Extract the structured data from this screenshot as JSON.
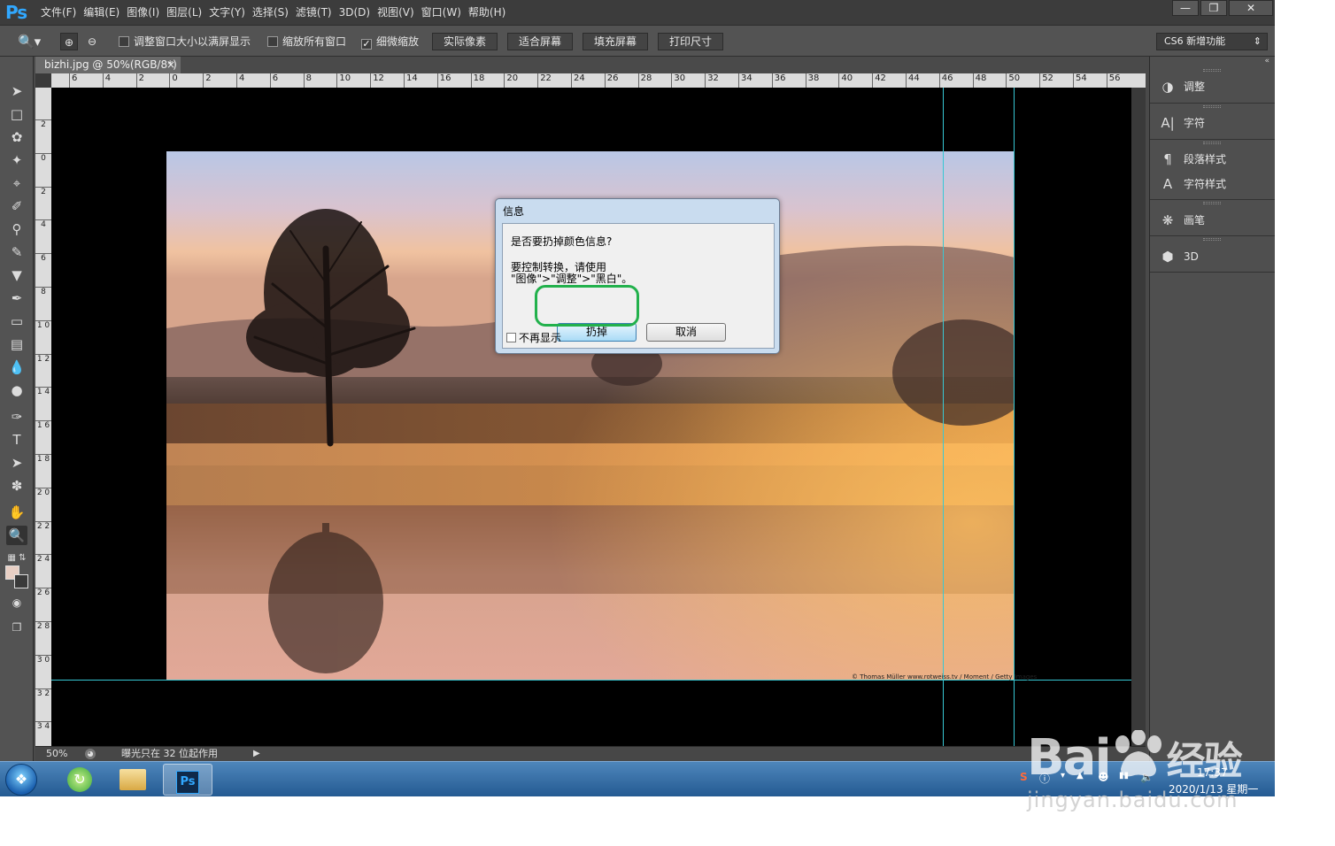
{
  "app": {
    "logo": "Ps",
    "menu": [
      "文件(F)",
      "编辑(E)",
      "图像(I)",
      "图层(L)",
      "文字(Y)",
      "选择(S)",
      "滤镜(T)",
      "3D(D)",
      "视图(V)",
      "窗口(W)",
      "帮助(H)"
    ],
    "window_controls": {
      "minimize": "—",
      "restore": "❐",
      "close": "✕"
    }
  },
  "options_bar": {
    "resize_windows_label": "调整窗口大小以满屏显示",
    "zoom_all_windows_label": "缩放所有窗口",
    "scrubby_zoom_label": "细微缩放",
    "scrubby_zoom_checked": true,
    "actual_pixels": "实际像素",
    "fit_screen": "适合屏幕",
    "fill_screen": "填充屏幕",
    "print_size": "打印尺寸",
    "workspace": "CS6 新增功能"
  },
  "document": {
    "tab_title": "bizhi.jpg @ 50%(RGB/8*)",
    "tab_close": "×",
    "ruler_top": [
      "6",
      "4",
      "2",
      "0",
      "2",
      "4",
      "6",
      "8",
      "10",
      "12",
      "14",
      "16",
      "18",
      "20",
      "22",
      "24",
      "26",
      "28",
      "30",
      "32",
      "34",
      "36",
      "38",
      "40",
      "42",
      "44",
      "46",
      "48",
      "50",
      "52",
      "54",
      "56"
    ],
    "ruler_left": [
      "2",
      "0",
      "2",
      "4",
      "6",
      "8",
      "1 0",
      "1 2",
      "1 4",
      "1 6",
      "1 8",
      "2 0",
      "2 2",
      "2 4",
      "2 6",
      "2 8",
      "3 0",
      "3 2",
      "3 4"
    ],
    "photo_credit": "© Thomas Müller www.rotweiss.tv / Moment / Getty Images"
  },
  "status_bar": {
    "zoom": "50%",
    "message": "曝光只在 32 位起作用"
  },
  "panels": [
    {
      "label": "调整",
      "icon": "adjustments-icon"
    },
    {
      "label": "字符",
      "icon": "character-icon"
    },
    {
      "label": "段落样式",
      "icon": "paragraph-styles-icon"
    },
    {
      "label": "字符样式",
      "icon": "character-styles-icon"
    },
    {
      "label": "画笔",
      "icon": "brush-icon"
    },
    {
      "label": "3D",
      "icon": "3d-icon"
    }
  ],
  "dialog": {
    "title": "信息",
    "question": "是否要扔掉颜色信息?",
    "hint_line1": "要控制转换，请使用",
    "hint_line2": "\"图像\">\"调整\">\"黑白\"。",
    "discard_button": "扔掉",
    "cancel_button": "取消",
    "dont_show_again": "不再显示"
  },
  "taskbar": {
    "clock_time": "17:37",
    "clock_date": "2020/1/13 星期一"
  },
  "watermark": {
    "brand": "Bai",
    "brand_cn": "经验",
    "url": "jingyan.baidu.com"
  },
  "colors": {
    "guide": "#37c8d4",
    "highlight": "#22b14c",
    "ps_blue": "#31a8ff"
  }
}
